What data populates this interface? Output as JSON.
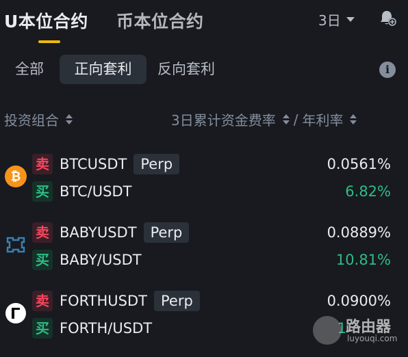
{
  "header": {
    "tabs": [
      {
        "label": "U本位合约",
        "active": true
      },
      {
        "label": "币本位合约",
        "active": false
      }
    ],
    "period": "3日",
    "icons": {
      "period_dropdown": "chevron-down-icon",
      "notification": "bell-plus-icon"
    }
  },
  "filters": {
    "items": [
      "全部",
      "正向套利",
      "反向套利"
    ],
    "selected": "正向套利",
    "info_icon": "info-icon"
  },
  "columns": {
    "left": "投资组合",
    "right_prefix": "3日累计资金费率",
    "right_sep": "/",
    "right_suffix": "年利率"
  },
  "rows": [
    {
      "coin_icon": "bitcoin-icon",
      "sell_badge": "卖",
      "sell_symbol": "BTCUSDT",
      "perp_label": "Perp",
      "buy_badge": "买",
      "buy_symbol": "BTC/USDT",
      "funding_rate": "0.0561%",
      "apr": "6.82%"
    },
    {
      "coin_icon": "babylon-icon",
      "sell_badge": "卖",
      "sell_symbol": "BABYUSDT",
      "perp_label": "Perp",
      "buy_badge": "买",
      "buy_symbol": "BABY/USDT",
      "funding_rate": "0.0889%",
      "apr": "10.81%"
    },
    {
      "coin_icon": "ampleforth-icon",
      "sell_badge": "卖",
      "sell_symbol": "FORTHUSDT",
      "perp_label": "Perp",
      "buy_badge": "买",
      "buy_symbol": "FORTH/USDT",
      "funding_rate": "0.0900%",
      "apr": "1"
    }
  ],
  "colors": {
    "background": "#181a20",
    "accent": "#f0b90b",
    "sell": "#f6465d",
    "buy": "#2ebd85"
  },
  "watermark": {
    "text": "路由器",
    "sub": "luyouqi.com"
  }
}
